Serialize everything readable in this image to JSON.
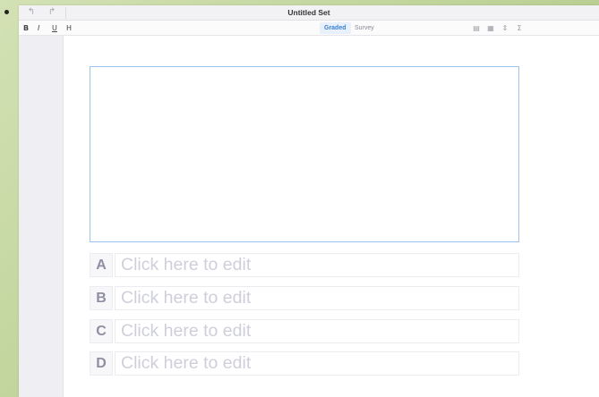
{
  "window": {
    "title": "Untitled Set"
  },
  "titlebar": {
    "back_icon": "arrow-left-icon",
    "forward_icon": "arrow-right-icon",
    "back_glyph": "↰",
    "forward_glyph": "↱"
  },
  "toolbar": {
    "format_buttons": [
      {
        "label": "B",
        "icon": "bold-icon"
      },
      {
        "label": "I",
        "icon": "italic-icon"
      },
      {
        "label": "U",
        "icon": "underline-icon"
      },
      {
        "label": "H",
        "icon": "heading-icon"
      }
    ],
    "mode_tabs": [
      {
        "label": "Graded",
        "selected": true
      },
      {
        "label": "Survey",
        "selected": false
      }
    ],
    "right_icons": [
      {
        "name": "insert-image-icon",
        "glyph": "▤"
      },
      {
        "name": "insert-table-icon",
        "glyph": "▦"
      },
      {
        "name": "insert-slider-icon",
        "glyph": "⇕"
      },
      {
        "name": "sigma-icon",
        "glyph": "Σ"
      }
    ]
  },
  "question": {
    "placeholder": ""
  },
  "choices": [
    {
      "letter": "A",
      "placeholder": "Click here to edit"
    },
    {
      "letter": "B",
      "placeholder": "Click here to edit"
    },
    {
      "letter": "C",
      "placeholder": "Click here to edit"
    },
    {
      "letter": "D",
      "placeholder": "Click here to edit"
    }
  ],
  "colors": {
    "accent": "#3b7fd0",
    "question_border": "#9cc4ec",
    "placeholder_text": "#cfcfdb",
    "desktop_bg": "#bfd49a"
  }
}
